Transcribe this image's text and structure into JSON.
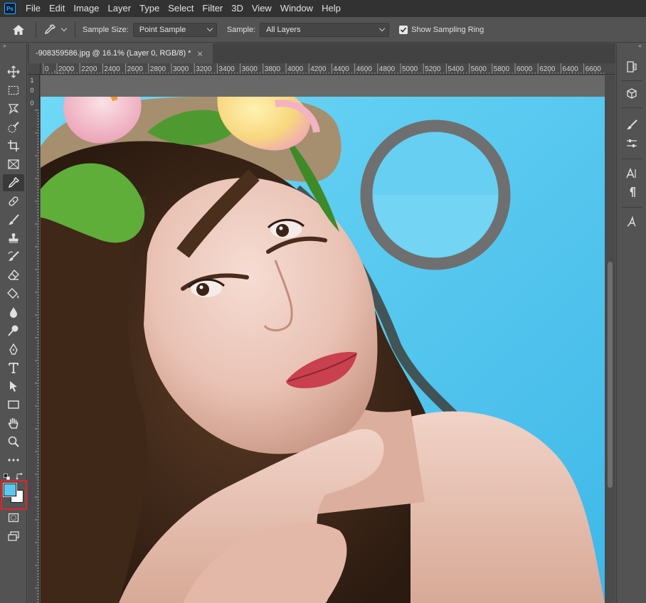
{
  "menu": {
    "logo": "Ps",
    "items": [
      "File",
      "Edit",
      "Image",
      "Layer",
      "Type",
      "Select",
      "Filter",
      "3D",
      "View",
      "Window",
      "Help"
    ]
  },
  "options": {
    "sample_size_label": "Sample Size:",
    "sample_size_value": "Point Sample",
    "sample_label": "Sample:",
    "sample_value": "All Layers",
    "show_ring_label": "Show Sampling Ring",
    "show_ring_checked": true
  },
  "document": {
    "tab_title": "-908359586.jpg @ 16.1% (Layer 0, RGB/8) *",
    "close": "×"
  },
  "ruler": {
    "h_labels": [
      "0",
      "2000",
      "2200",
      "2400",
      "2600",
      "2800",
      "3000",
      "3200",
      "3400",
      "3600",
      "3800",
      "4000",
      "4200",
      "4400",
      "4600",
      "4800",
      "5000",
      "5200",
      "5400",
      "5600",
      "5800",
      "6000",
      "6200",
      "6400",
      "6600"
    ],
    "v_top_labels": [
      "1",
      "0",
      "0"
    ]
  },
  "colors": {
    "foreground": "#5bc8ef",
    "background": "#ffffff",
    "ring": "#6f6f6f",
    "sky": "#5fd0f2",
    "highlight": "#e0242b"
  },
  "tools": [
    "move-icon",
    "marquee-icon",
    "lasso-icon",
    "quick-select-icon",
    "crop-icon",
    "frame-icon",
    "eyedropper-icon",
    "healing-icon",
    "brush-icon",
    "stamp-icon",
    "history-brush-icon",
    "eraser-icon",
    "bucket-icon",
    "blur-icon",
    "dodge-icon",
    "pen-icon",
    "type-icon",
    "path-select-icon",
    "rectangle-icon",
    "hand-icon",
    "zoom-icon",
    "more-icon"
  ]
}
